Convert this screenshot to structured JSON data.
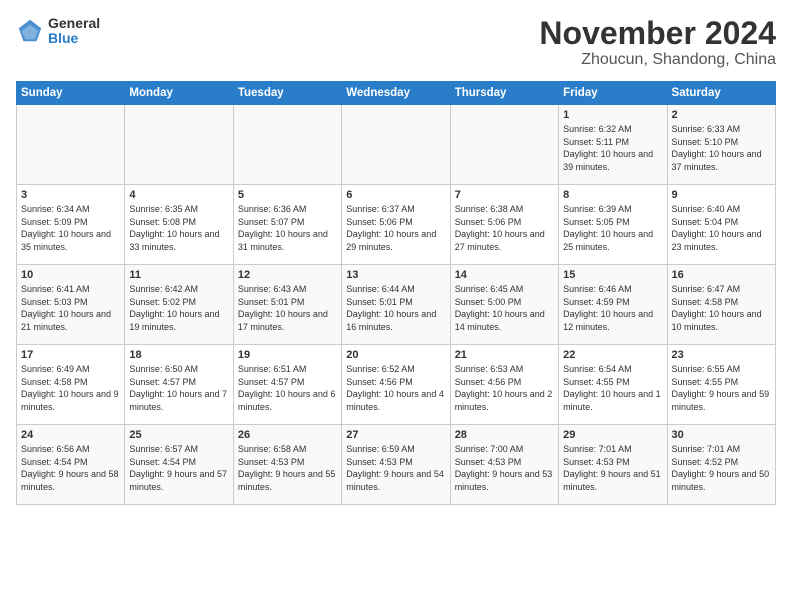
{
  "header": {
    "logo_general": "General",
    "logo_blue": "Blue",
    "month_title": "November 2024",
    "location": "Zhoucun, Shandong, China"
  },
  "days_of_week": [
    "Sunday",
    "Monday",
    "Tuesday",
    "Wednesday",
    "Thursday",
    "Friday",
    "Saturday"
  ],
  "weeks": [
    [
      {
        "day": "",
        "info": ""
      },
      {
        "day": "",
        "info": ""
      },
      {
        "day": "",
        "info": ""
      },
      {
        "day": "",
        "info": ""
      },
      {
        "day": "",
        "info": ""
      },
      {
        "day": "1",
        "info": "Sunrise: 6:32 AM\nSunset: 5:11 PM\nDaylight: 10 hours and 39 minutes."
      },
      {
        "day": "2",
        "info": "Sunrise: 6:33 AM\nSunset: 5:10 PM\nDaylight: 10 hours and 37 minutes."
      }
    ],
    [
      {
        "day": "3",
        "info": "Sunrise: 6:34 AM\nSunset: 5:09 PM\nDaylight: 10 hours and 35 minutes."
      },
      {
        "day": "4",
        "info": "Sunrise: 6:35 AM\nSunset: 5:08 PM\nDaylight: 10 hours and 33 minutes."
      },
      {
        "day": "5",
        "info": "Sunrise: 6:36 AM\nSunset: 5:07 PM\nDaylight: 10 hours and 31 minutes."
      },
      {
        "day": "6",
        "info": "Sunrise: 6:37 AM\nSunset: 5:06 PM\nDaylight: 10 hours and 29 minutes."
      },
      {
        "day": "7",
        "info": "Sunrise: 6:38 AM\nSunset: 5:06 PM\nDaylight: 10 hours and 27 minutes."
      },
      {
        "day": "8",
        "info": "Sunrise: 6:39 AM\nSunset: 5:05 PM\nDaylight: 10 hours and 25 minutes."
      },
      {
        "day": "9",
        "info": "Sunrise: 6:40 AM\nSunset: 5:04 PM\nDaylight: 10 hours and 23 minutes."
      }
    ],
    [
      {
        "day": "10",
        "info": "Sunrise: 6:41 AM\nSunset: 5:03 PM\nDaylight: 10 hours and 21 minutes."
      },
      {
        "day": "11",
        "info": "Sunrise: 6:42 AM\nSunset: 5:02 PM\nDaylight: 10 hours and 19 minutes."
      },
      {
        "day": "12",
        "info": "Sunrise: 6:43 AM\nSunset: 5:01 PM\nDaylight: 10 hours and 17 minutes."
      },
      {
        "day": "13",
        "info": "Sunrise: 6:44 AM\nSunset: 5:01 PM\nDaylight: 10 hours and 16 minutes."
      },
      {
        "day": "14",
        "info": "Sunrise: 6:45 AM\nSunset: 5:00 PM\nDaylight: 10 hours and 14 minutes."
      },
      {
        "day": "15",
        "info": "Sunrise: 6:46 AM\nSunset: 4:59 PM\nDaylight: 10 hours and 12 minutes."
      },
      {
        "day": "16",
        "info": "Sunrise: 6:47 AM\nSunset: 4:58 PM\nDaylight: 10 hours and 10 minutes."
      }
    ],
    [
      {
        "day": "17",
        "info": "Sunrise: 6:49 AM\nSunset: 4:58 PM\nDaylight: 10 hours and 9 minutes."
      },
      {
        "day": "18",
        "info": "Sunrise: 6:50 AM\nSunset: 4:57 PM\nDaylight: 10 hours and 7 minutes."
      },
      {
        "day": "19",
        "info": "Sunrise: 6:51 AM\nSunset: 4:57 PM\nDaylight: 10 hours and 6 minutes."
      },
      {
        "day": "20",
        "info": "Sunrise: 6:52 AM\nSunset: 4:56 PM\nDaylight: 10 hours and 4 minutes."
      },
      {
        "day": "21",
        "info": "Sunrise: 6:53 AM\nSunset: 4:56 PM\nDaylight: 10 hours and 2 minutes."
      },
      {
        "day": "22",
        "info": "Sunrise: 6:54 AM\nSunset: 4:55 PM\nDaylight: 10 hours and 1 minute."
      },
      {
        "day": "23",
        "info": "Sunrise: 6:55 AM\nSunset: 4:55 PM\nDaylight: 9 hours and 59 minutes."
      }
    ],
    [
      {
        "day": "24",
        "info": "Sunrise: 6:56 AM\nSunset: 4:54 PM\nDaylight: 9 hours and 58 minutes."
      },
      {
        "day": "25",
        "info": "Sunrise: 6:57 AM\nSunset: 4:54 PM\nDaylight: 9 hours and 57 minutes."
      },
      {
        "day": "26",
        "info": "Sunrise: 6:58 AM\nSunset: 4:53 PM\nDaylight: 9 hours and 55 minutes."
      },
      {
        "day": "27",
        "info": "Sunrise: 6:59 AM\nSunset: 4:53 PM\nDaylight: 9 hours and 54 minutes."
      },
      {
        "day": "28",
        "info": "Sunrise: 7:00 AM\nSunset: 4:53 PM\nDaylight: 9 hours and 53 minutes."
      },
      {
        "day": "29",
        "info": "Sunrise: 7:01 AM\nSunset: 4:53 PM\nDaylight: 9 hours and 51 minutes."
      },
      {
        "day": "30",
        "info": "Sunrise: 7:01 AM\nSunset: 4:52 PM\nDaylight: 9 hours and 50 minutes."
      }
    ]
  ]
}
